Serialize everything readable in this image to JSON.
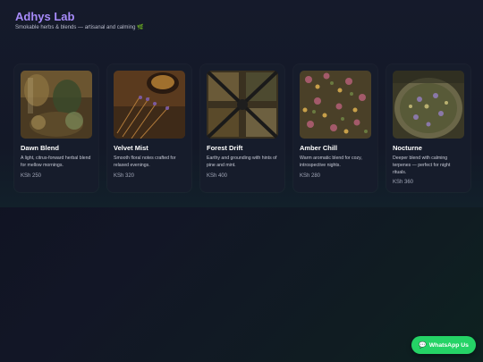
{
  "header": {
    "brand": "Adhys Lab",
    "tagline": "Smokable herbs & blends — artisanal and calming 🌿"
  },
  "products": [
    {
      "name": "Dawn Blend",
      "description": "A light, citrus-forward herbal blend for mellow mornings.",
      "price": "KSh 250",
      "image": "glass-jars-of-dried-herbs"
    },
    {
      "name": "Velvet Mist",
      "description": "Smooth floral notes crafted for relaxed evenings.",
      "price": "KSh 320",
      "image": "bowl-of-dried-lavender"
    },
    {
      "name": "Forest Drift",
      "description": "Earthy and grounding with hints of pine and mint.",
      "price": "KSh 400",
      "image": "divided-tray-of-herbs"
    },
    {
      "name": "Amber Chill",
      "description": "Warm aromatic blend for cozy, introspective nights.",
      "price": "KSh 280",
      "image": "dried-rosebuds-and-herbs"
    },
    {
      "name": "Nocturne",
      "description": "Deeper blend with calming terpenes — perfect for night rituals.",
      "price": "KSh 360",
      "image": "herbal-tea-blend-bowl"
    }
  ],
  "whatsapp": {
    "label": "WhatsApp Us",
    "icon": "chat-bubble-icon"
  },
  "colors": {
    "brand": "#a78bfa",
    "whatsapp": "#25d366",
    "card": "#161c2b"
  }
}
